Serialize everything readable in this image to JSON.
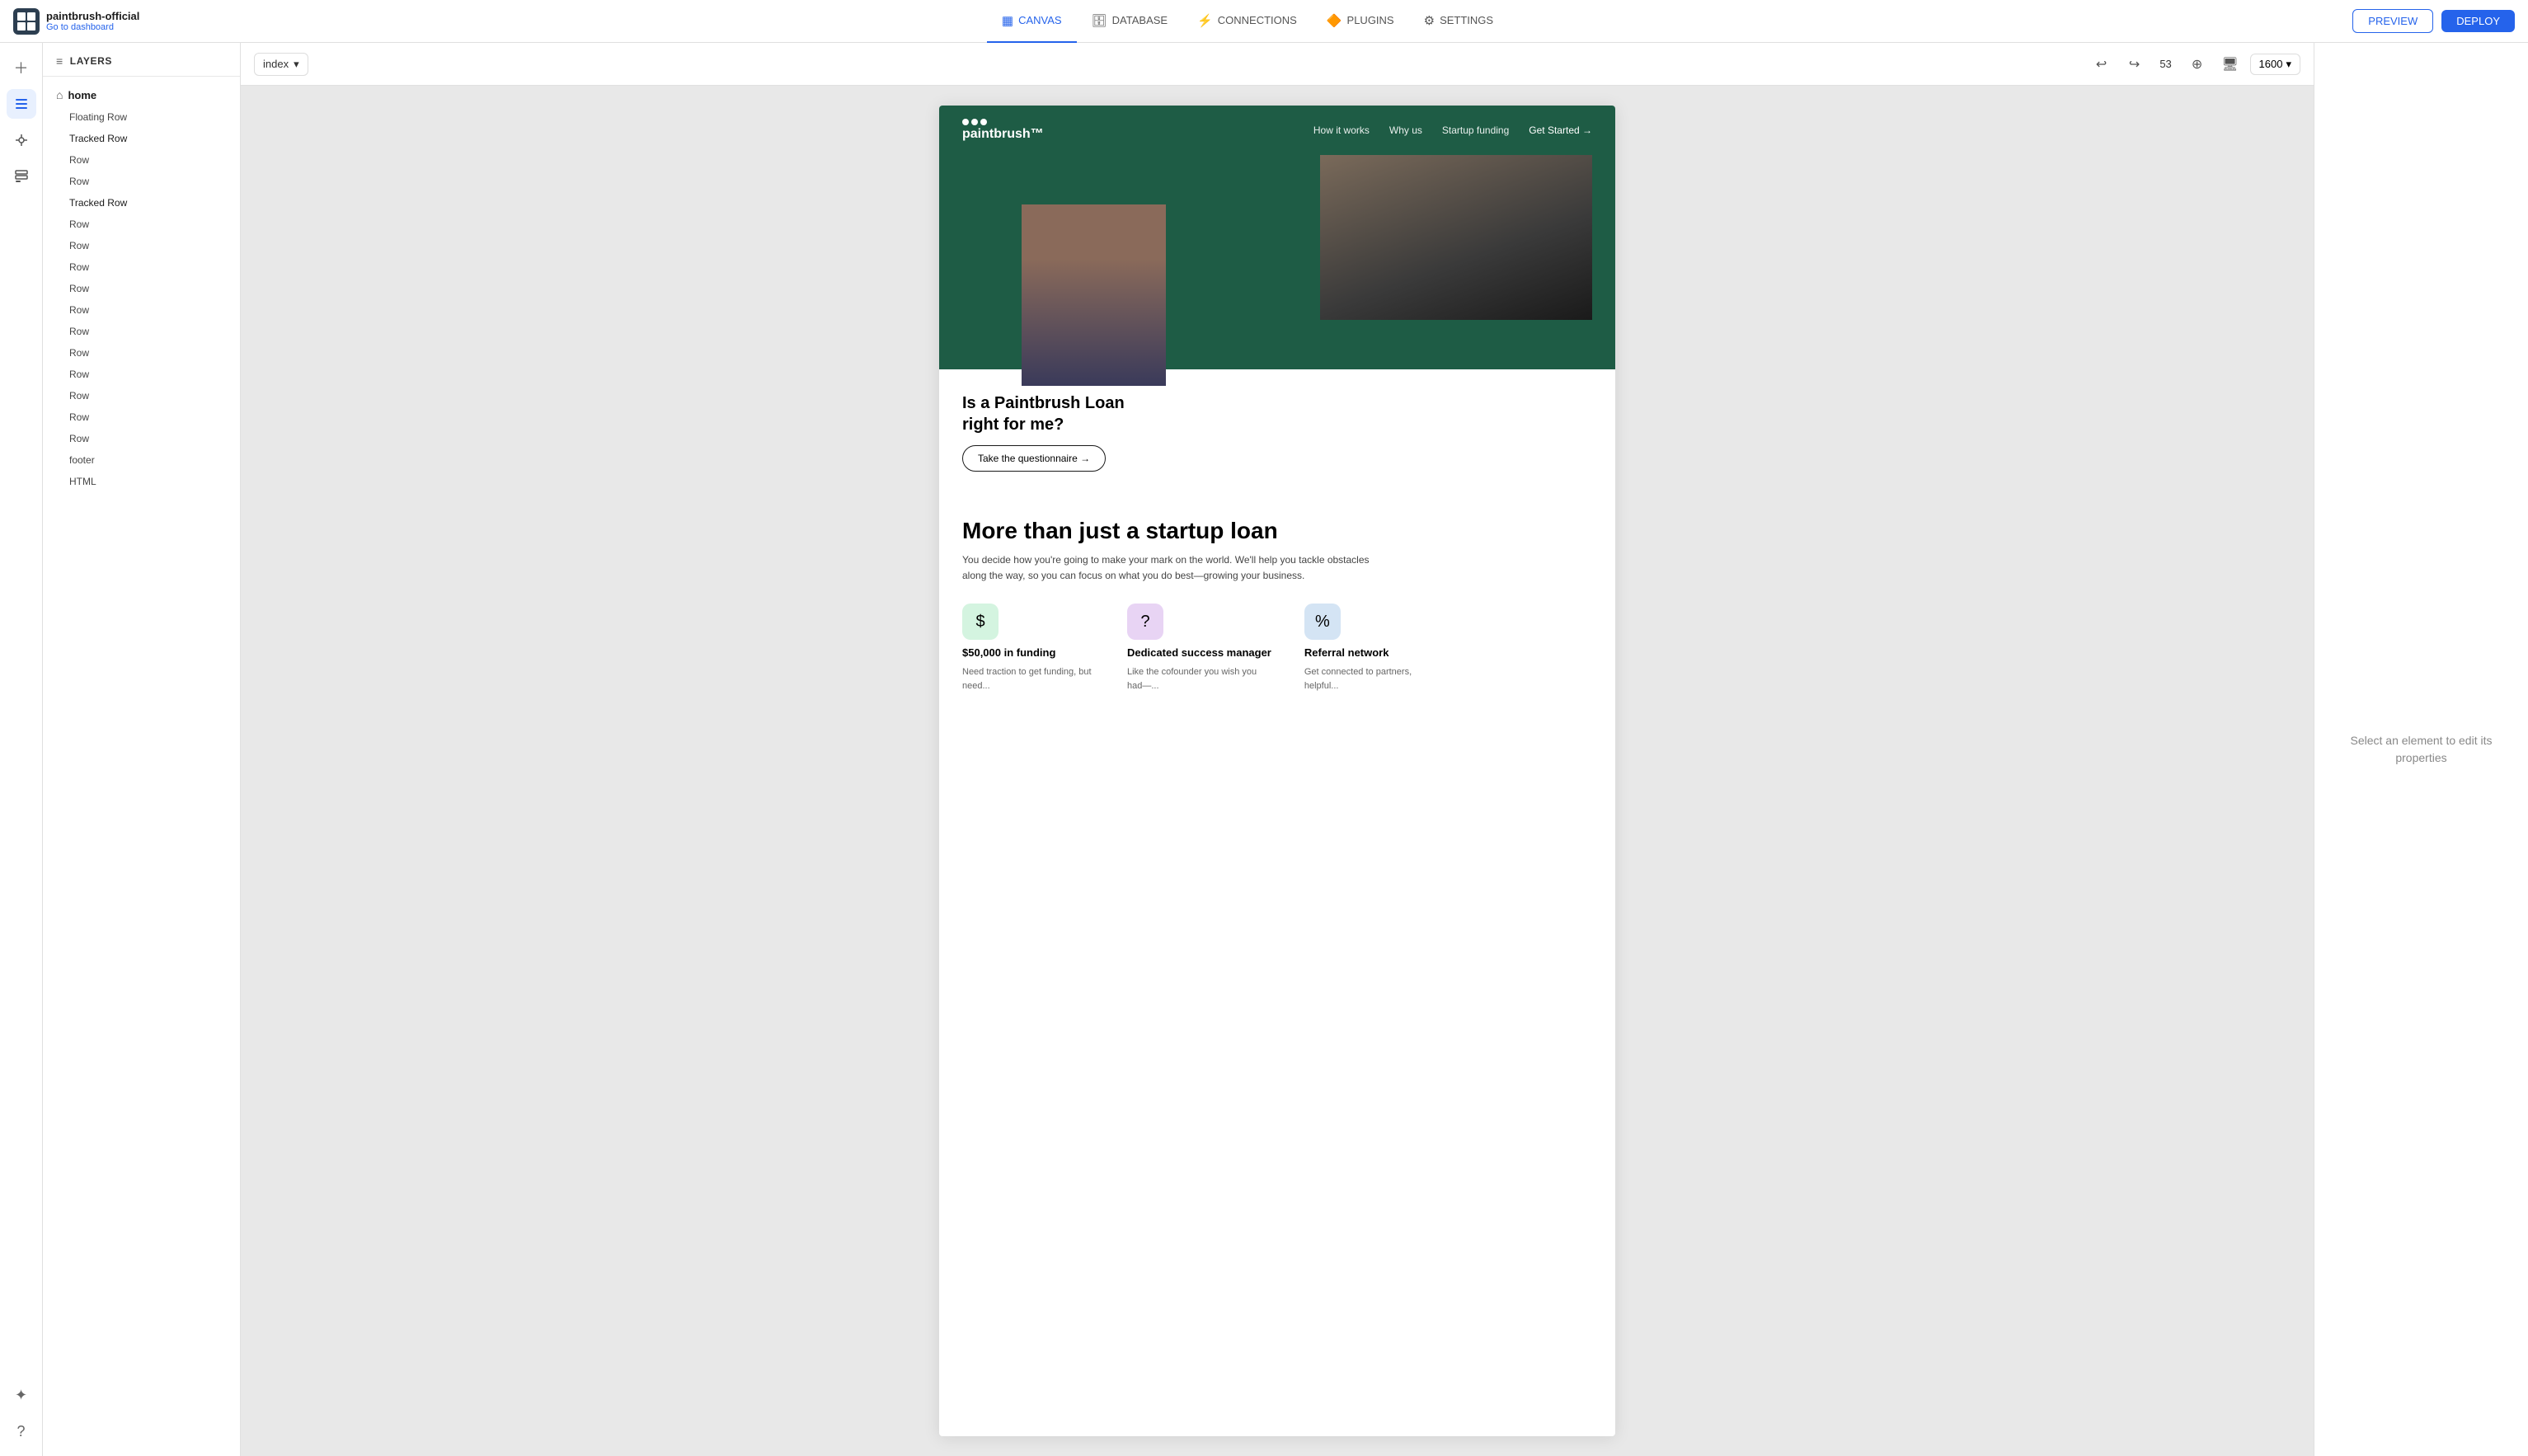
{
  "app": {
    "title": "paintbrush-official",
    "subtitle": "Go to dashboard"
  },
  "nav": {
    "tabs": [
      {
        "id": "canvas",
        "label": "CANVAS",
        "icon": "▦",
        "active": true
      },
      {
        "id": "database",
        "label": "DATABASE",
        "icon": "🗄"
      },
      {
        "id": "connections",
        "label": "CONNECTIONS",
        "icon": "⚡"
      },
      {
        "id": "plugins",
        "label": "PLUGINS",
        "icon": "🔶"
      },
      {
        "id": "settings",
        "label": "SETTINGS",
        "icon": "⚙"
      }
    ],
    "preview_label": "PREVIEW",
    "deploy_label": "DEPLOY"
  },
  "sidebar": {
    "panel_label": "LAYERS",
    "home_label": "home",
    "layers": [
      {
        "label": "Floating Row",
        "type": "floating"
      },
      {
        "label": "Tracked Row",
        "type": "tracked"
      },
      {
        "label": "Row",
        "type": "row"
      },
      {
        "label": "Row",
        "type": "row"
      },
      {
        "label": "Tracked Row",
        "type": "tracked"
      },
      {
        "label": "Row",
        "type": "row"
      },
      {
        "label": "Row",
        "type": "row"
      },
      {
        "label": "Row",
        "type": "row"
      },
      {
        "label": "Row",
        "type": "row"
      },
      {
        "label": "Row",
        "type": "row"
      },
      {
        "label": "Row",
        "type": "row"
      },
      {
        "label": "Row",
        "type": "row"
      },
      {
        "label": "Row",
        "type": "row"
      },
      {
        "label": "Row",
        "type": "row"
      },
      {
        "label": "Row",
        "type": "row"
      },
      {
        "label": "Row",
        "type": "row"
      },
      {
        "label": "footer",
        "type": "footer"
      },
      {
        "label": "HTML",
        "type": "html"
      }
    ]
  },
  "canvas": {
    "page_label": "index",
    "zoom": "53",
    "width": "1600",
    "undo_label": "↩",
    "redo_label": "↪"
  },
  "site": {
    "logo": "paintbrush™",
    "nav_links": [
      "How it works",
      "Why us",
      "Startup funding",
      "Get Started →"
    ],
    "hero_card_title": "Is a Paintbrush Loan\nright for me?",
    "hero_card_btn": "Take the questionnaire →",
    "big_title": "More than just a startup loan",
    "big_desc": "You decide how you're going to make your mark on the world. We'll help you tackle obstacles along the way, so you can focus on what you do best—growing your business.",
    "features": [
      {
        "icon": "$",
        "icon_class": "green",
        "label": "$50,000 in funding",
        "desc": "Need traction to get funding, but need..."
      },
      {
        "icon": "?",
        "icon_class": "purple",
        "label": "Dedicated success manager",
        "desc": "Like the cofounder you wish you had—..."
      },
      {
        "icon": "%",
        "icon_class": "blue",
        "label": "Referral network",
        "desc": "Get connected to partners, helpful..."
      }
    ]
  },
  "properties": {
    "placeholder": "Select an element to edit its properties"
  }
}
